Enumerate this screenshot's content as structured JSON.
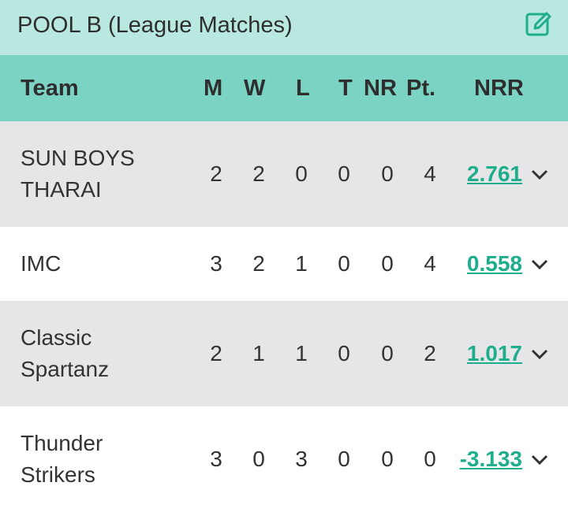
{
  "title": "POOL B (League Matches)",
  "edit_icon": "edit-icon",
  "columns": {
    "team": "Team",
    "m": "M",
    "w": "W",
    "l": "L",
    "t": "T",
    "nr": "NR",
    "pt": "Pt.",
    "nrr": "NRR"
  },
  "rows": [
    {
      "team_line1": "SUN BOYS",
      "team_line2": "THARAI",
      "m": "2",
      "w": "2",
      "l": "0",
      "t": "0",
      "nr": "0",
      "pt": "4",
      "nrr": "2.761"
    },
    {
      "team_line1": "IMC",
      "team_line2": "",
      "m": "3",
      "w": "2",
      "l": "1",
      "t": "0",
      "nr": "0",
      "pt": "4",
      "nrr": "0.558"
    },
    {
      "team_line1": "Classic",
      "team_line2": "Spartanz",
      "m": "2",
      "w": "1",
      "l": "1",
      "t": "0",
      "nr": "0",
      "pt": "2",
      "nrr": "1.017"
    },
    {
      "team_line1": "Thunder",
      "team_line2": "Strikers",
      "m": "3",
      "w": "0",
      "l": "3",
      "t": "0",
      "nr": "0",
      "pt": "0",
      "nrr": "-3.133"
    }
  ],
  "colors": {
    "title_bg": "#b8e8df",
    "header_bg": "#7ad3c3",
    "row_alt_bg": "#e6e6e8",
    "nrr_link": "#1fae8c"
  }
}
